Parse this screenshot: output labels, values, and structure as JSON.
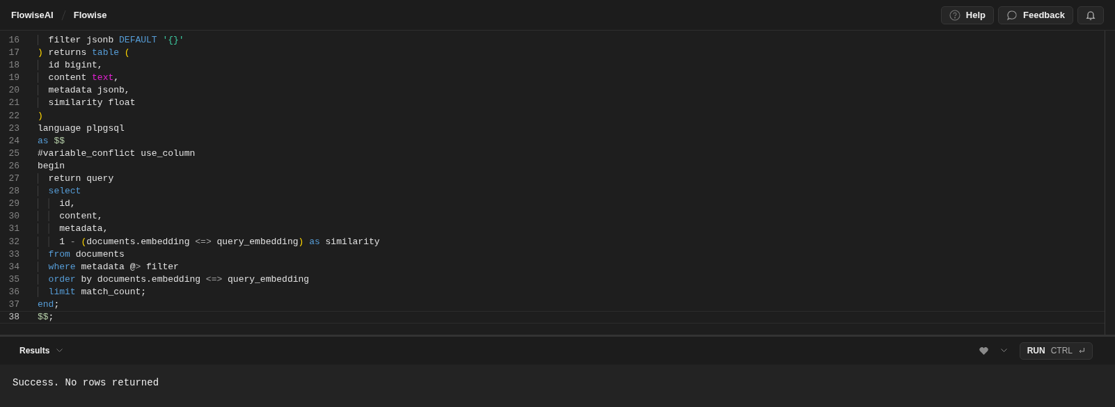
{
  "topbar": {
    "breadcrumbs": [
      {
        "label": "FlowiseAI"
      },
      {
        "label": "Flowise"
      }
    ],
    "buttons": [
      {
        "kind": "help",
        "label": "Help"
      },
      {
        "kind": "feedback",
        "label": "Feedback"
      },
      {
        "kind": "notifications"
      }
    ]
  },
  "editor": {
    "lines": [
      {
        "number": "16",
        "current": false,
        "tokens": [
          {
            "kind": "plain",
            "text": "  filter jsonb "
          },
          {
            "kind": "keyword",
            "text": "DEFAULT "
          },
          {
            "kind": "string",
            "text": "'{}'"
          }
        ]
      },
      {
        "number": "17",
        "current": false,
        "tokens": [
          {
            "kind": "paren",
            "text": ")"
          },
          {
            "kind": "plain",
            "text": " returns "
          },
          {
            "kind": "keyword",
            "text": "table "
          },
          {
            "kind": "paren",
            "text": "("
          }
        ]
      },
      {
        "number": "18",
        "current": false,
        "tokens": [
          {
            "kind": "plain",
            "text": "  id bigint,"
          }
        ]
      },
      {
        "number": "19",
        "current": false,
        "tokens": [
          {
            "kind": "plain",
            "text": "  content "
          },
          {
            "kind": "type",
            "text": "text"
          },
          {
            "kind": "plain",
            "text": ","
          }
        ]
      },
      {
        "number": "20",
        "current": false,
        "tokens": [
          {
            "kind": "plain",
            "text": "  metadata jsonb,"
          }
        ]
      },
      {
        "number": "21",
        "current": false,
        "tokens": [
          {
            "kind": "plain",
            "text": "  similarity float"
          }
        ]
      },
      {
        "number": "22",
        "current": false,
        "tokens": [
          {
            "kind": "paren",
            "text": ")"
          }
        ]
      },
      {
        "number": "23",
        "current": false,
        "tokens": [
          {
            "kind": "plain",
            "text": "language plpgsql"
          }
        ]
      },
      {
        "number": "24",
        "current": false,
        "tokens": [
          {
            "kind": "keyword",
            "text": "as "
          },
          {
            "kind": "dollar",
            "text": "$$"
          }
        ]
      },
      {
        "number": "25",
        "current": false,
        "tokens": [
          {
            "kind": "plain",
            "text": "#variable_conflict use_column"
          }
        ]
      },
      {
        "number": "26",
        "current": false,
        "tokens": [
          {
            "kind": "plain",
            "text": "begin"
          }
        ]
      },
      {
        "number": "27",
        "current": false,
        "tokens": [
          {
            "kind": "plain",
            "text": "  return query"
          }
        ]
      },
      {
        "number": "28",
        "current": false,
        "tokens": [
          {
            "kind": "keyword",
            "text": "  select"
          }
        ]
      },
      {
        "number": "29",
        "current": false,
        "tokens": [
          {
            "kind": "plain",
            "text": "    id,"
          }
        ]
      },
      {
        "number": "30",
        "current": false,
        "tokens": [
          {
            "kind": "plain",
            "text": "    content,"
          }
        ]
      },
      {
        "number": "31",
        "current": false,
        "tokens": [
          {
            "kind": "plain",
            "text": "    metadata,"
          }
        ]
      },
      {
        "number": "32",
        "current": false,
        "tokens": [
          {
            "kind": "plain",
            "text": "    1 "
          },
          {
            "kind": "operator",
            "text": "- "
          },
          {
            "kind": "paren",
            "text": "("
          },
          {
            "kind": "plain",
            "text": "documents.embedding "
          },
          {
            "kind": "operator",
            "text": "<=>"
          },
          {
            "kind": "plain",
            "text": " query_embedding"
          },
          {
            "kind": "paren",
            "text": ")"
          },
          {
            "kind": "keyword",
            "text": " as"
          },
          {
            "kind": "plain",
            "text": " similarity"
          }
        ]
      },
      {
        "number": "33",
        "current": false,
        "tokens": [
          {
            "kind": "keyword",
            "text": "  from"
          },
          {
            "kind": "plain",
            "text": " documents"
          }
        ]
      },
      {
        "number": "34",
        "current": false,
        "tokens": [
          {
            "kind": "keyword",
            "text": "  where"
          },
          {
            "kind": "plain",
            "text": " metadata @"
          },
          {
            "kind": "operator",
            "text": ">"
          },
          {
            "kind": "plain",
            "text": " filter"
          }
        ]
      },
      {
        "number": "35",
        "current": false,
        "tokens": [
          {
            "kind": "keyword",
            "text": "  order"
          },
          {
            "kind": "plain",
            "text": " by documents.embedding "
          },
          {
            "kind": "operator",
            "text": "<=>"
          },
          {
            "kind": "plain",
            "text": " query_embedding"
          }
        ]
      },
      {
        "number": "36",
        "current": false,
        "tokens": [
          {
            "kind": "keyword",
            "text": "  limit"
          },
          {
            "kind": "plain",
            "text": " match_count;"
          }
        ]
      },
      {
        "number": "37",
        "current": false,
        "tokens": [
          {
            "kind": "keyword",
            "text": "end"
          },
          {
            "kind": "plain",
            "text": ";"
          }
        ]
      },
      {
        "number": "38",
        "current": true,
        "tokens": [
          {
            "kind": "dollar",
            "text": "$$"
          },
          {
            "kind": "plain",
            "text": ";"
          }
        ]
      }
    ]
  },
  "results": {
    "title": "Results",
    "run_button": {
      "label": "RUN",
      "shortcut": "CTRL"
    },
    "message": "Success. No rows returned"
  }
}
